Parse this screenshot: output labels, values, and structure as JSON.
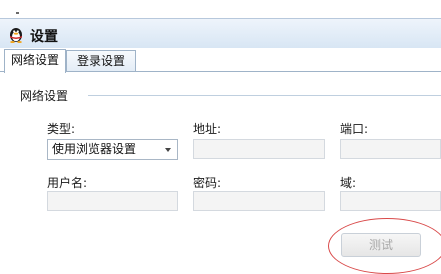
{
  "window": {
    "title": "设置"
  },
  "tabs": [
    {
      "label": "网络设置",
      "active": true
    },
    {
      "label": "登录设置",
      "active": false
    }
  ],
  "group": {
    "title": "网络设置"
  },
  "fields": {
    "type": {
      "label": "类型:",
      "value": "使用浏览器设置"
    },
    "address": {
      "label": "地址:",
      "value": ""
    },
    "port": {
      "label": "端口:",
      "value": ""
    },
    "username": {
      "label": "用户名:",
      "value": ""
    },
    "password": {
      "label": "密码:",
      "value": ""
    },
    "domain": {
      "label": "域:",
      "value": ""
    }
  },
  "buttons": {
    "test_label": "测试"
  },
  "colors": {
    "annotation": "#d94a4a",
    "titlebar": "#d8e6f4",
    "tab_border": "#9fb3c8"
  },
  "icons": {
    "app": "penguin-icon",
    "dropdown": "chevron-down-icon"
  }
}
